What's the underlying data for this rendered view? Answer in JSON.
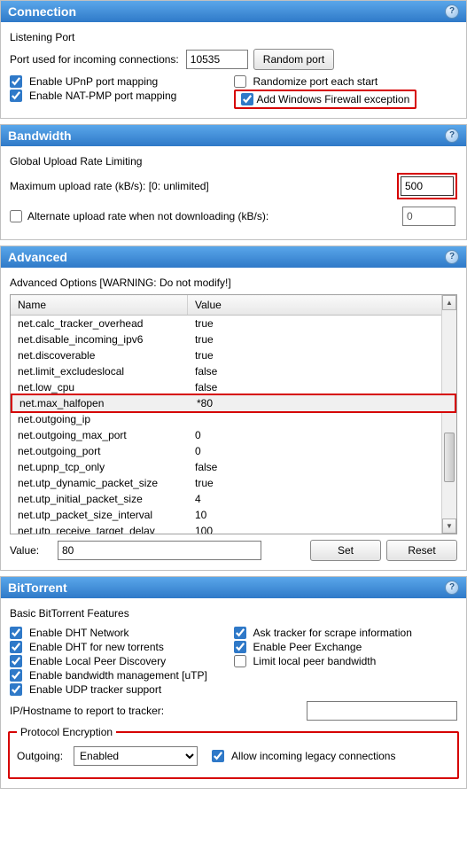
{
  "connection": {
    "title": "Connection",
    "listening_port_label": "Listening Port",
    "port_used_label": "Port used for incoming connections:",
    "port_value": "10535",
    "random_port_btn": "Random port",
    "enable_upnp": "Enable UPnP port mapping",
    "enable_natpmp": "Enable NAT-PMP port mapping",
    "randomize_each_start": "Randomize port each start",
    "add_firewall": "Add Windows Firewall exception"
  },
  "bandwidth": {
    "title": "Bandwidth",
    "global_upload_label": "Global Upload Rate Limiting",
    "max_upload_label": "Maximum upload rate (kB/s): [0: unlimited]",
    "max_upload_value": "500",
    "alt_upload_label": "Alternate upload rate when not downloading (kB/s):",
    "alt_upload_value": "0"
  },
  "advanced": {
    "title": "Advanced",
    "warning": "Advanced Options [WARNING: Do not modify!]",
    "col_name": "Name",
    "col_value": "Value",
    "rows": [
      {
        "name": "net.calc_tracker_overhead",
        "value": "true"
      },
      {
        "name": "net.disable_incoming_ipv6",
        "value": "true"
      },
      {
        "name": "net.discoverable",
        "value": "true"
      },
      {
        "name": "net.limit_excludeslocal",
        "value": "false"
      },
      {
        "name": "net.low_cpu",
        "value": "false"
      },
      {
        "name": "net.max_halfopen",
        "value": "*80"
      },
      {
        "name": "net.outgoing_ip",
        "value": ""
      },
      {
        "name": "net.outgoing_max_port",
        "value": "0"
      },
      {
        "name": "net.outgoing_port",
        "value": "0"
      },
      {
        "name": "net.upnp_tcp_only",
        "value": "false"
      },
      {
        "name": "net.utp_dynamic_packet_size",
        "value": "true"
      },
      {
        "name": "net.utp_initial_packet_size",
        "value": "4"
      },
      {
        "name": "net.utp_packet_size_interval",
        "value": "10"
      },
      {
        "name": "net.utp_receive_target_delay",
        "value": "100"
      }
    ],
    "value_label": "Value:",
    "value_input": "80",
    "set_btn": "Set",
    "reset_btn": "Reset"
  },
  "bittorrent": {
    "title": "BitTorrent",
    "basic_label": "Basic BitTorrent Features",
    "enable_dht": "Enable DHT Network",
    "enable_dht_new": "Enable DHT for new torrents",
    "enable_lpd": "Enable Local Peer Discovery",
    "enable_utp": "Enable bandwidth management [uTP]",
    "enable_udp_tracker": "Enable UDP tracker support",
    "ask_tracker": "Ask tracker for scrape information",
    "enable_pex": "Enable Peer Exchange",
    "limit_local": "Limit local peer bandwidth",
    "ip_host_label": "IP/Hostname to report to tracker:",
    "ip_host_value": "",
    "protocol_label": "Protocol Encryption",
    "outgoing_label": "Outgoing:",
    "outgoing_value": "Enabled",
    "allow_legacy": "Allow incoming legacy connections"
  }
}
